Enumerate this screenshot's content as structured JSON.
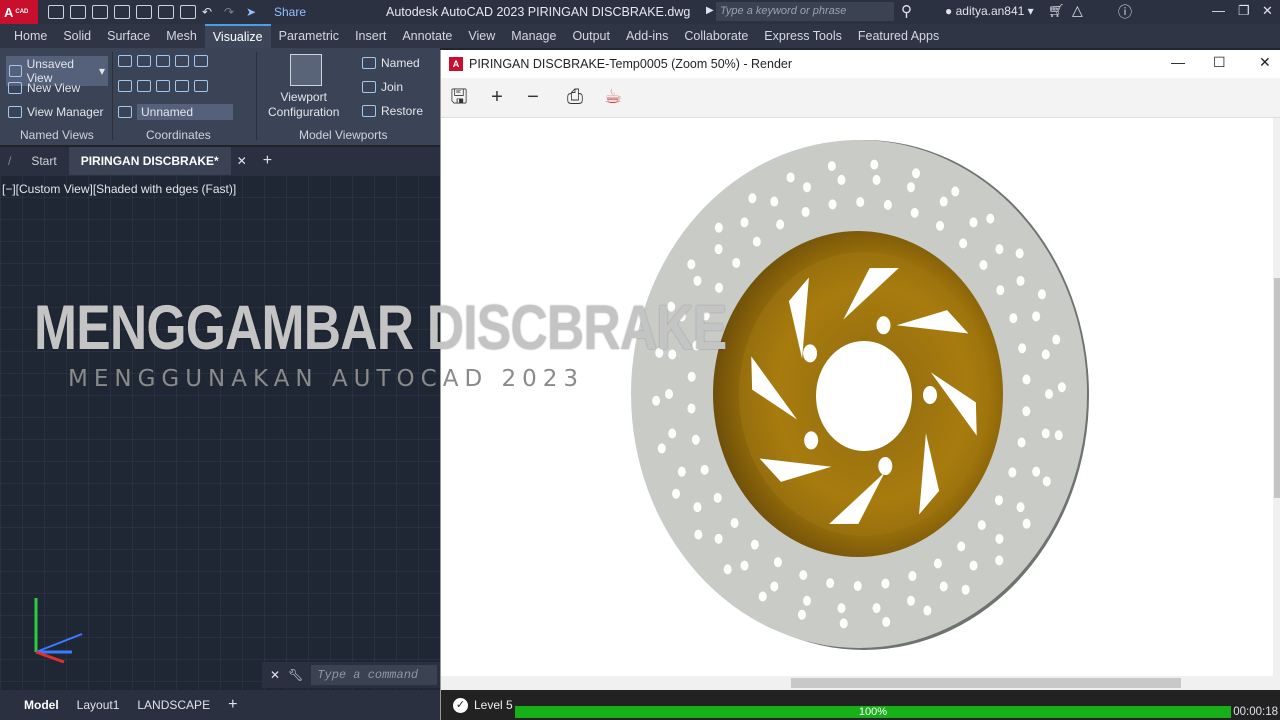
{
  "titlebar": {
    "logo": "A",
    "logo_sub": "CAD",
    "share": "Share",
    "app_title": "Autodesk AutoCAD 2023    PIRINGAN DISCBRAKE.dwg",
    "search_placeholder": "Type a keyword or phrase",
    "user": "aditya.an841"
  },
  "ribbon_tabs": [
    "Home",
    "Solid",
    "Surface",
    "Mesh",
    "Visualize",
    "Parametric",
    "Insert",
    "Annotate",
    "View",
    "Manage",
    "Output",
    "Add-ins",
    "Collaborate",
    "Express Tools",
    "Featured Apps"
  ],
  "ribbon": {
    "unsaved_view": "Unsaved View",
    "new_view": "New View",
    "view_manager": "View Manager",
    "unnamed": "Unnamed",
    "viewport_config_1": "Viewport",
    "viewport_config_2": "Configuration",
    "named": "Named",
    "join": "Join",
    "restore": "Restore",
    "group_named_views": "Named Views",
    "group_coordinates": "Coordinates",
    "group_model_viewports": "Model Viewports"
  },
  "file_tabs": {
    "start": "Start",
    "active": "PIRINGAN DISCBRAKE*"
  },
  "view_label": "[−][Custom View][Shaded with edges (Fast)]",
  "command": {
    "placeholder": "Type a command"
  },
  "layout_tabs": [
    "Model",
    "Layout1",
    "LANDSCAPE"
  ],
  "render_window": {
    "title": "PIRINGAN DISCBRAKE-Temp0005 (Zoom 50%) - Render",
    "status_level": "Level 5",
    "progress_label": "100%",
    "progress": 1.0,
    "elapsed": "00:00:18"
  },
  "overlay": {
    "headline": "MENGGAMBAR DISCBRAKE",
    "subheadline": "MENGGUNAKAN AUTOCAD 2023"
  },
  "colors": {
    "accent": "#4b9fe8",
    "brand": "#c8102e",
    "progress": "#18b018",
    "rotor": "#c9ccc6",
    "hub": "#b8860b"
  }
}
